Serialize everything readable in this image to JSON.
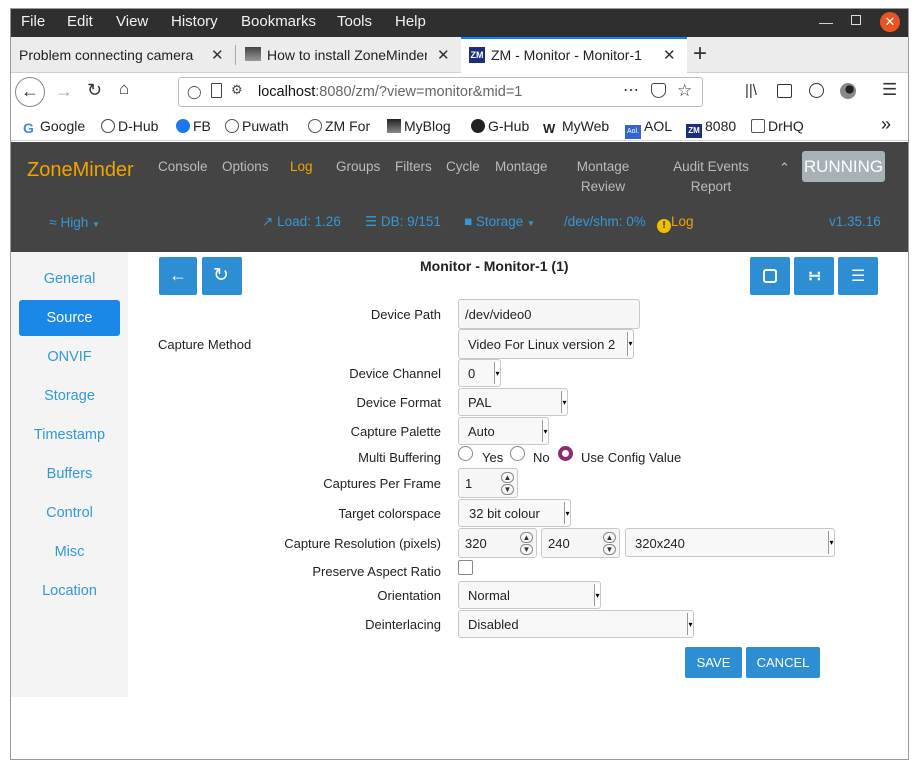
{
  "menu": [
    "File",
    "Edit",
    "View",
    "History",
    "Bookmarks",
    "Tools",
    "Help"
  ],
  "tabs": [
    {
      "title": "Problem connecting camera"
    },
    {
      "title": "How to install ZoneMinder"
    },
    {
      "title": "ZM - Monitor - Monitor-1"
    }
  ],
  "url": {
    "host": "localhost",
    "rest": ":8080/zm/?view=monitor&mid=1"
  },
  "bookmarks": [
    "Google",
    "D-Hub",
    "FB",
    "Puwath",
    "ZM For",
    "MyBlog",
    "G-Hub",
    "MyWeb",
    "AOL",
    "8080",
    "DrHQ"
  ],
  "zm": {
    "brand": "ZoneMinder",
    "nav": [
      "Console",
      "Options",
      "Log",
      "Groups",
      "Filters",
      "Cycle",
      "Montage"
    ],
    "nav_montage_review": [
      "Montage",
      "Review"
    ],
    "nav_audit": [
      "Audit Events",
      "Report"
    ],
    "running": "RUNNING",
    "status": {
      "bandwidth": "High",
      "load": "Load: 1.26",
      "db": "DB: 9/151",
      "storage": "Storage",
      "shm": "/dev/shm: 0%",
      "log": "Log",
      "version": "v1.35.16"
    }
  },
  "sidebar": [
    "General",
    "Source",
    "ONVIF",
    "Storage",
    "Timestamp",
    "Buffers",
    "Control",
    "Misc",
    "Location"
  ],
  "page_title": "Monitor - Monitor-1 (1)",
  "form": {
    "device_path": {
      "label": "Device Path",
      "value": "/dev/video0"
    },
    "capture_method": {
      "label": "Capture Method",
      "value": "Video For Linux version 2"
    },
    "device_channel": {
      "label": "Device Channel",
      "value": "0"
    },
    "device_format": {
      "label": "Device Format",
      "value": "PAL"
    },
    "capture_palette": {
      "label": "Capture Palette",
      "value": "Auto"
    },
    "multi_buffering": {
      "label": "Multi Buffering",
      "yes": "Yes",
      "no": "No",
      "config": "Use Config Value"
    },
    "captures_per_frame": {
      "label": "Captures Per Frame",
      "value": "1"
    },
    "target_colorspace": {
      "label": "Target colorspace",
      "value": "32 bit colour"
    },
    "capture_resolution": {
      "label": "Capture Resolution (pixels)",
      "width": "320",
      "height": "240",
      "preset": "320x240"
    },
    "preserve_aspect": {
      "label": "Preserve Aspect Ratio"
    },
    "orientation": {
      "label": "Orientation",
      "value": "Normal"
    },
    "deinterlacing": {
      "label": "Deinterlacing",
      "value": "Disabled"
    },
    "save": "SAVE",
    "cancel": "CANCEL"
  }
}
